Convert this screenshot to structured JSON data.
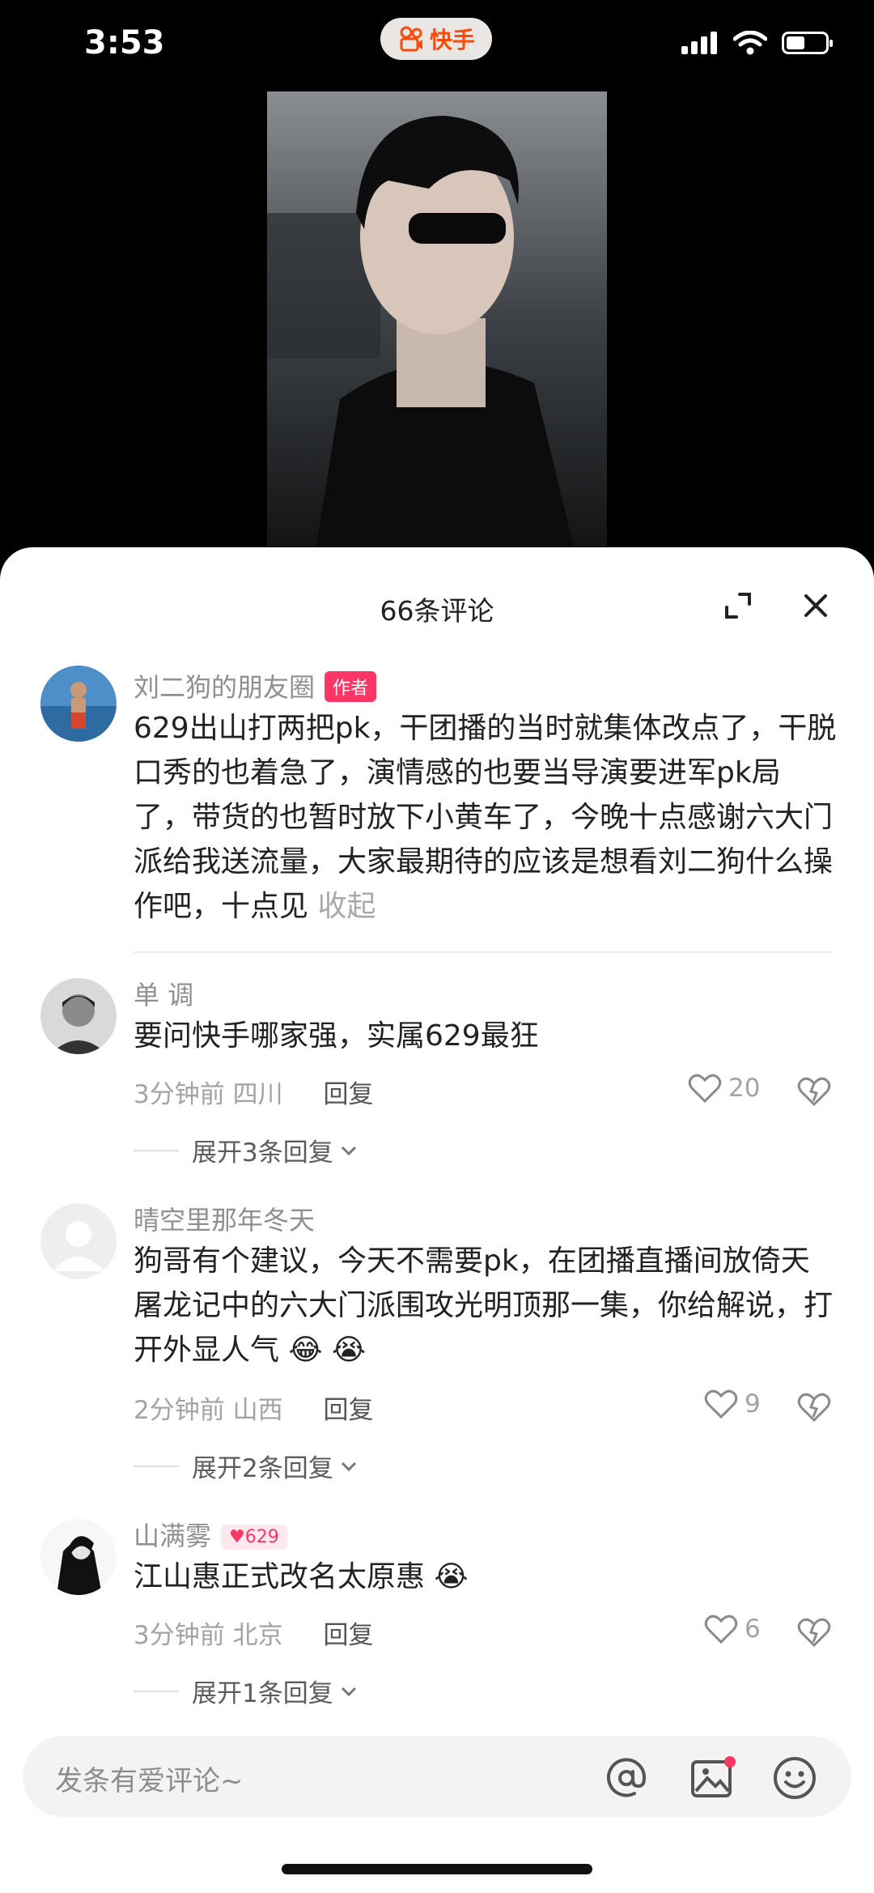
{
  "status_bar": {
    "time": "3:53",
    "app_name": "快手"
  },
  "sheet": {
    "title": "66条评论"
  },
  "comments": [
    {
      "username": "刘二狗的朋友圈",
      "badge": "作者",
      "text": "629出山打两把pk，干团播的当时就集体改点了，干脱口秀的也着急了，演情感的也要当导演要进军pk局了，带货的也暂时放下小黄车了，今晚十点感谢六大门派给我送流量，大家最期待的应该是想看刘二狗什么操作吧，十点见",
      "collapse_label": "收起"
    },
    {
      "username": "单 调",
      "text": "要问快手哪家强，实属629最狂",
      "time": "3分钟前",
      "location": "四川",
      "reply_label": "回复",
      "likes": "20",
      "expand_label": "展开3条回复"
    },
    {
      "username": "晴空里那年冬天",
      "text": "狗哥有个建议，今天不需要pk，在团播直播间放倚天屠龙记中的六大门派围攻光明顶那一集，你给解说，打开外显人气 😂 😭",
      "time": "2分钟前",
      "location": "山西",
      "reply_label": "回复",
      "likes": "9",
      "expand_label": "展开2条回复"
    },
    {
      "username": "山满雾",
      "badge": "629",
      "text": "江山惠正式改名太原惠 😭",
      "time": "3分钟前",
      "location": "北京",
      "reply_label": "回复",
      "likes": "6",
      "expand_label": "展开1条回复"
    }
  ],
  "input": {
    "placeholder": "发条有爱评论~"
  },
  "colors": {
    "accent": "#fe3666",
    "brand": "#ff4906"
  }
}
